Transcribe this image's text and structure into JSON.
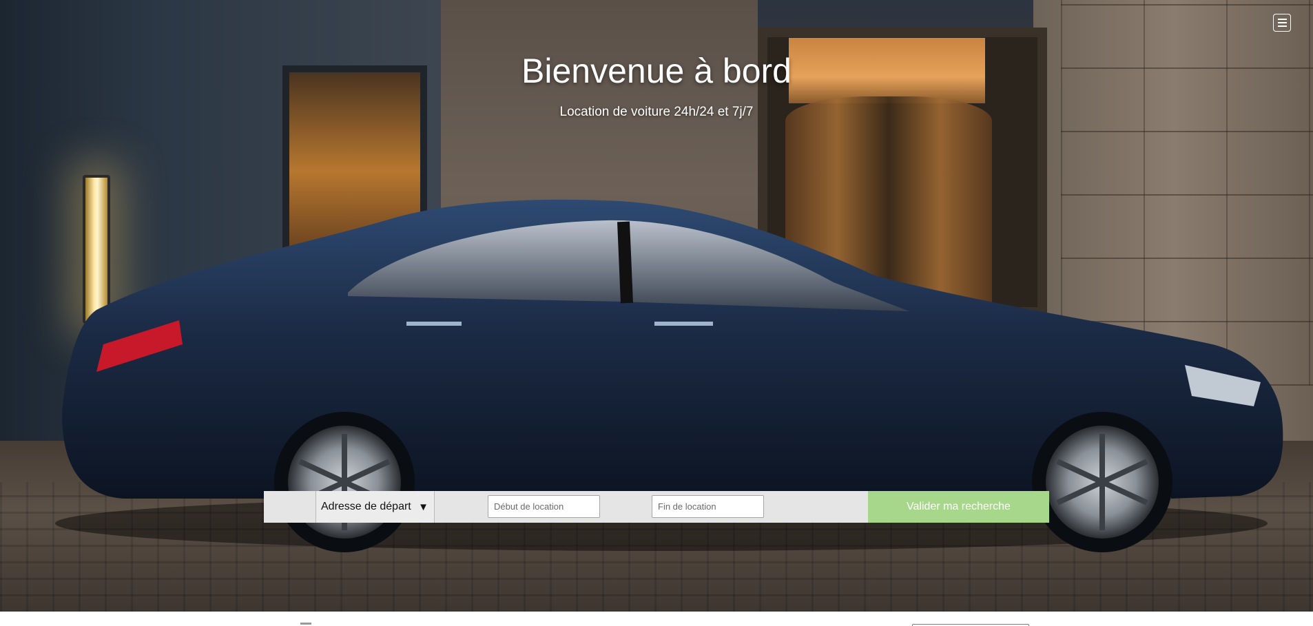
{
  "hero": {
    "title": "Bienvenue à bord",
    "subtitle": "Location de voiture 24h/24 et 7j/7"
  },
  "nav": {
    "menu_icon": "hamburger-menu-icon"
  },
  "search": {
    "address_select_label": "Adresse de départ",
    "address_select_caret": "▼",
    "start_placeholder": "Début de location",
    "end_placeholder": "Fin de location",
    "submit_label": "Valider ma recherche"
  },
  "colors": {
    "submit_bg": "#a6d78a",
    "search_bar_bg": "#e5e5e5",
    "car_body": "#1b2a44"
  }
}
